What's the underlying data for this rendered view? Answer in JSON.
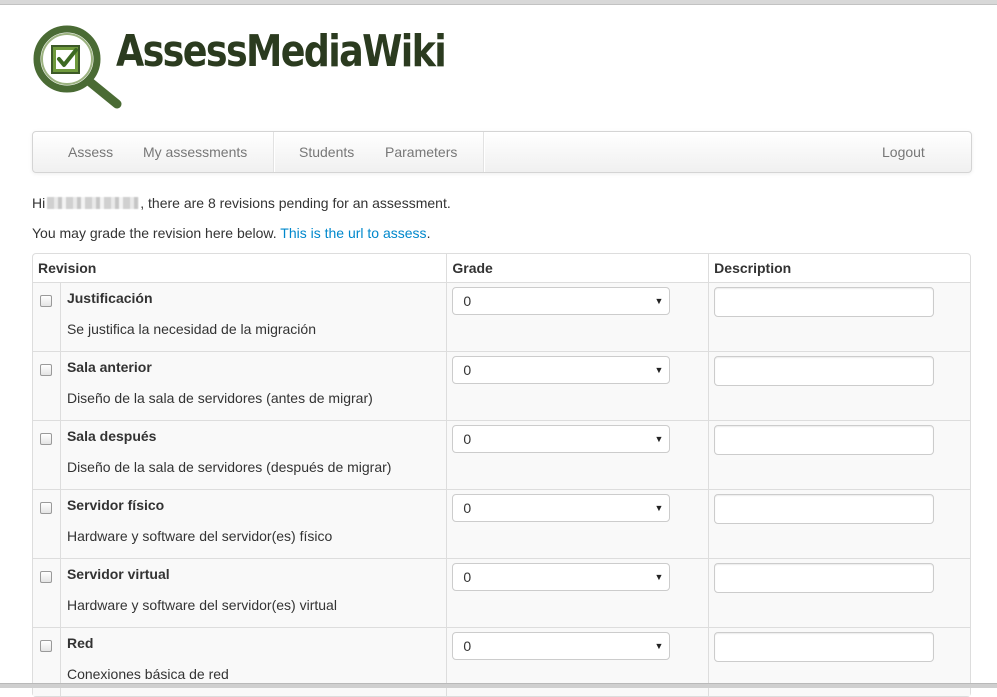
{
  "logo": {
    "text": "AssessMediaWiki"
  },
  "nav": {
    "assess": "Assess",
    "my_assessments": "My assessments",
    "students": "Students",
    "parameters": "Parameters",
    "logout": "Logout"
  },
  "greeting": {
    "prefix": "Hi",
    "suffix": ", there are 8 revisions pending for an assessment."
  },
  "hint": {
    "text": "You may grade the revision here below. ",
    "link": "This is the url to assess",
    "end": "."
  },
  "table": {
    "headers": {
      "revision": "Revision",
      "grade": "Grade",
      "description": "Description"
    },
    "rows": [
      {
        "name": "Justificación",
        "desc": "Se justifica la necesidad de la migración",
        "grade": "0",
        "description": ""
      },
      {
        "name": "Sala anterior",
        "desc": "Diseño de la sala de servidores (antes de migrar)",
        "grade": "0",
        "description": ""
      },
      {
        "name": "Sala después",
        "desc": "Diseño de la sala de servidores (después de migrar)",
        "grade": "0",
        "description": ""
      },
      {
        "name": "Servidor físico",
        "desc": "Hardware y software del servidor(es) físico",
        "grade": "0",
        "description": ""
      },
      {
        "name": "Servidor virtual",
        "desc": "Hardware y software del servidor(es) virtual",
        "grade": "0",
        "description": ""
      },
      {
        "name": "Red",
        "desc": "Conexiones básica de red",
        "grade": "0",
        "description": ""
      }
    ]
  },
  "colors": {
    "logo_green": "#4a6b34",
    "logo_text": "#2b3b1f",
    "link": "#0088cc"
  },
  "icons": {
    "logo": "magnifier-check-icon",
    "dropdown": "caret-down-icon"
  }
}
